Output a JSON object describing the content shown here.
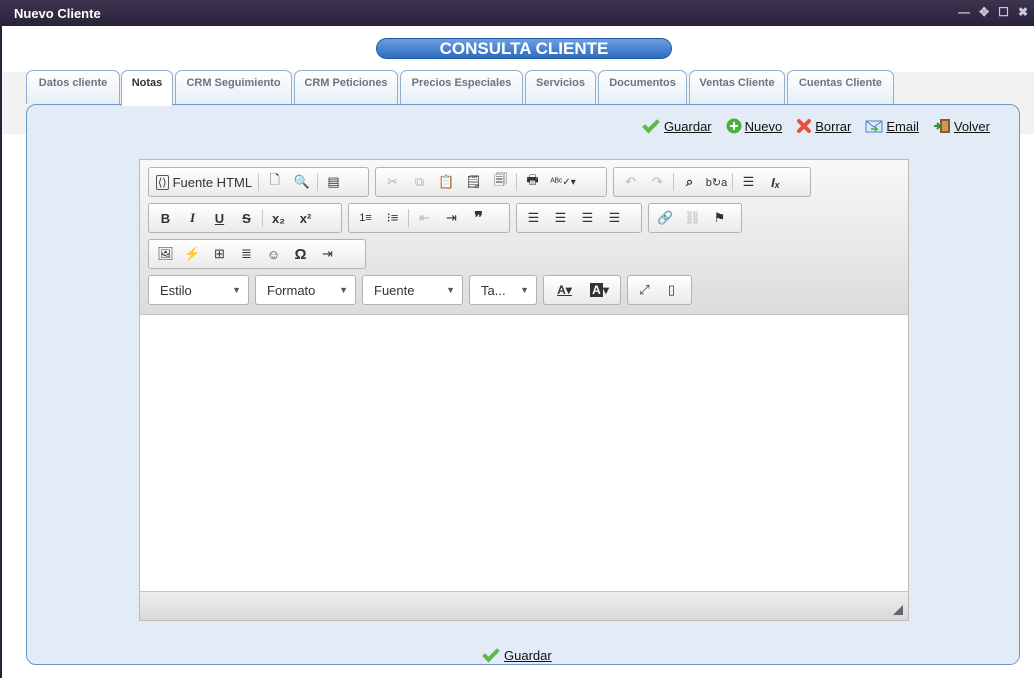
{
  "window": {
    "title": "Nuevo Cliente",
    "controls": [
      "—",
      "✥",
      "☐",
      "✖"
    ]
  },
  "page": {
    "heading": "CONSULTA CLIENTE"
  },
  "tabs": [
    {
      "label": "Datos cliente",
      "active": false
    },
    {
      "label": "Notas",
      "active": true
    },
    {
      "label": "CRM Seguimiento",
      "active": false
    },
    {
      "label": "CRM Peticiones",
      "active": false
    },
    {
      "label": "Precios Especiales",
      "active": false
    },
    {
      "label": "Servicios",
      "active": false
    },
    {
      "label": "Documentos",
      "active": false
    },
    {
      "label": "Ventas Cliente",
      "active": false
    },
    {
      "label": "Cuentas Cliente",
      "active": false
    }
  ],
  "actions": {
    "save": "Guardar",
    "new": "Nuevo",
    "delete": "Borrar",
    "email": "Email",
    "back": "Volver"
  },
  "editor": {
    "source_label": "Fuente HTML",
    "combos": {
      "style": "Estilo",
      "format": "Formato",
      "font": "Fuente",
      "size": "Ta..."
    },
    "content": ""
  },
  "footer": {
    "save": "Guardar"
  },
  "colors": {
    "heading": "#2d6cbf",
    "titlebar": "#2a2238",
    "panel": "#e3ecf6",
    "check": "#5db84a",
    "delete": "#e8513c",
    "new": "#4caf3c"
  }
}
